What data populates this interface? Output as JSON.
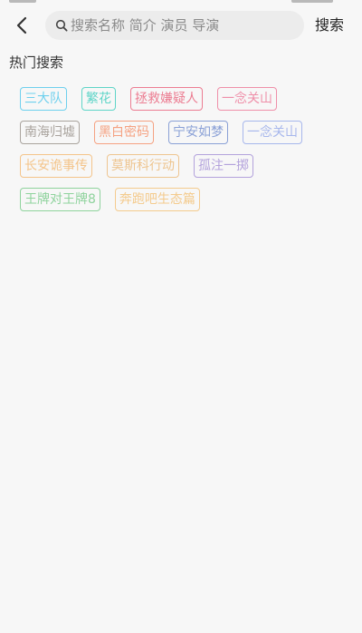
{
  "header": {
    "search_placeholder": "搜索名称 简介 演员 导演",
    "search_button": "搜索"
  },
  "hot_search": {
    "title": "热门搜索",
    "rows": [
      [
        {
          "label": "三大队",
          "color": "#6ed0ee"
        },
        {
          "label": "繁花",
          "color": "#5fd5c8"
        },
        {
          "label": "拯救嫌疑人",
          "color": "#ec7d92"
        },
        {
          "label": "一念关山",
          "color": "#ef8fa9"
        }
      ],
      [
        {
          "label": "南海归墟",
          "color": "#a9a39d"
        },
        {
          "label": "黑白密码",
          "color": "#f5a282"
        },
        {
          "label": "宁安如梦",
          "color": "#8aa0d6"
        },
        {
          "label": "一念关山",
          "color": "#a7b7ec"
        }
      ],
      [
        {
          "label": "长安诡事传",
          "color": "#f4c48a"
        },
        {
          "label": "莫斯科行动",
          "color": "#eec590"
        },
        {
          "label": "孤注一掷",
          "color": "#b3a2dc"
        }
      ],
      [
        {
          "label": "王牌对王牌8",
          "color": "#8fd39d"
        },
        {
          "label": "奔跑吧生态篇",
          "color": "#f4cb8e"
        }
      ]
    ]
  }
}
